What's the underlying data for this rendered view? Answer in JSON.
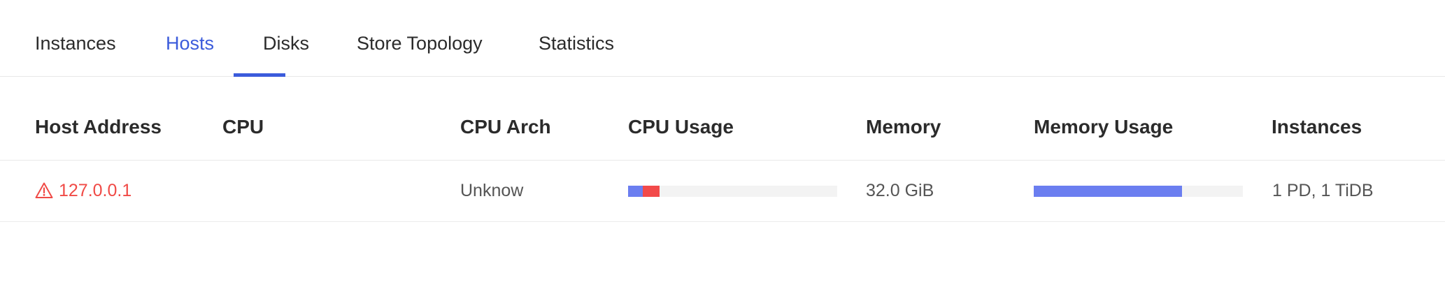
{
  "tabs": [
    {
      "label": "Instances",
      "active": false
    },
    {
      "label": "Hosts",
      "active": true
    },
    {
      "label": "Disks",
      "active": false
    },
    {
      "label": "Store Topology",
      "active": false
    },
    {
      "label": "Statistics",
      "active": false
    }
  ],
  "table": {
    "columns": [
      "Host Address",
      "CPU",
      "CPU Arch",
      "CPU Usage",
      "Memory",
      "Memory Usage",
      "Instances"
    ],
    "rows": [
      {
        "host_address": "127.0.0.1",
        "host_icon": "warning-triangle-icon",
        "cpu": "",
        "cpu_arch": "Unknow",
        "cpu_usage": {
          "user_fraction": 0.07,
          "system_fraction": 0.08
        },
        "memory": "32.0 GiB",
        "memory_usage_fraction": 0.71,
        "instances": "1 PD, 1 TiDB"
      }
    ]
  },
  "colors": {
    "accent": "#3b5bdb",
    "warning": "#f04a46",
    "usage_bar": "#6b7ef0",
    "usage_bar_alt": "#f24a4a",
    "bar_track": "#f3f3f3"
  }
}
